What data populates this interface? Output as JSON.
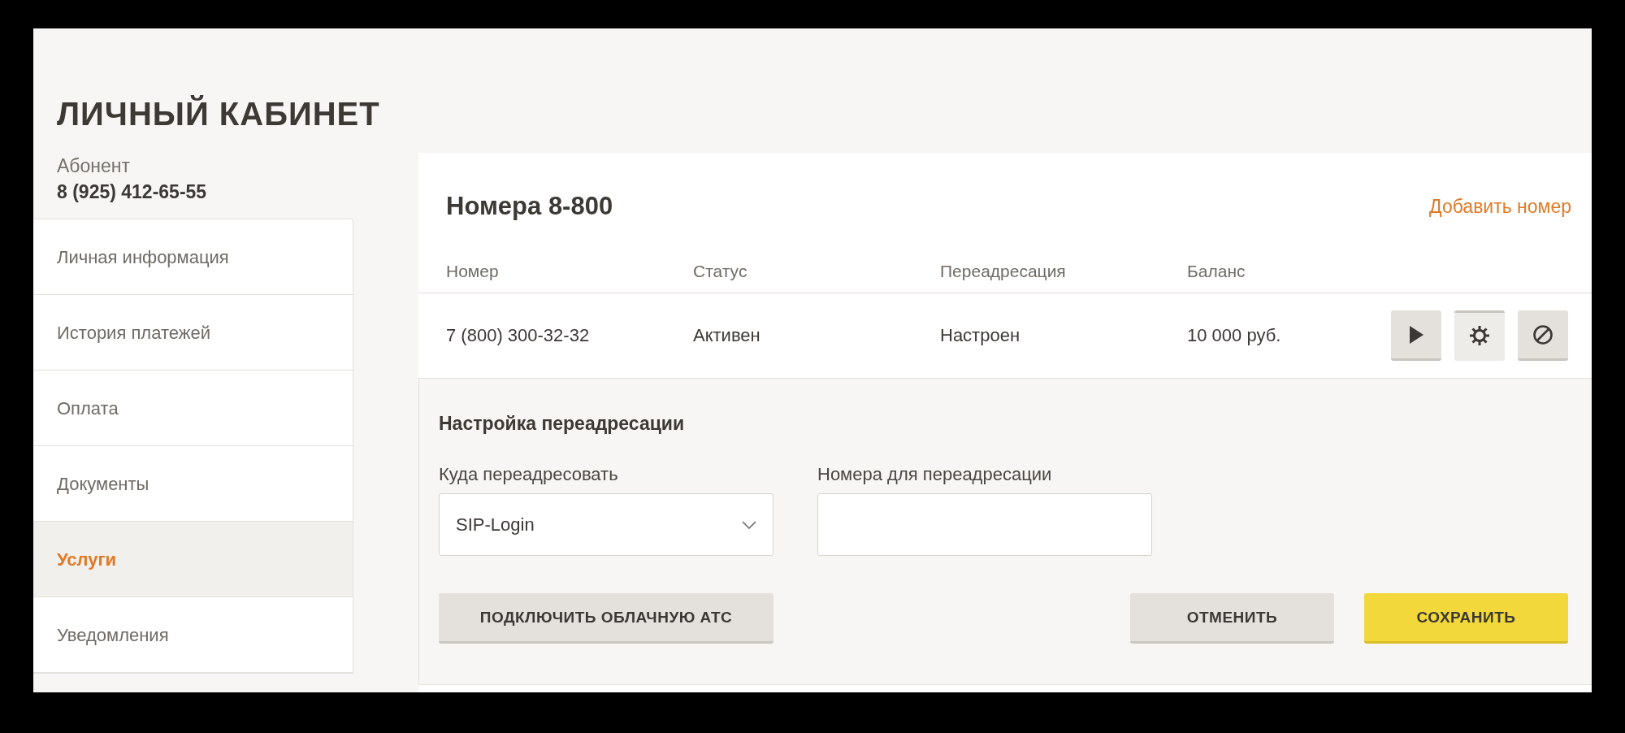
{
  "page": {
    "title": "ЛИЧНЫЙ КАБИНЕТ"
  },
  "subscriber": {
    "label": "Абонент",
    "phone": "8 (925) 412-65-55"
  },
  "sidebar": {
    "items": [
      {
        "label": "Личная информация",
        "selected": false
      },
      {
        "label": "История платежей",
        "selected": false
      },
      {
        "label": "Оплата",
        "selected": false
      },
      {
        "label": "Документы",
        "selected": false
      },
      {
        "label": "Услуги",
        "selected": true
      },
      {
        "label": "Уведомления",
        "selected": false
      }
    ]
  },
  "panel": {
    "title": "Номера 8-800",
    "add_link": "Добавить номер",
    "table": {
      "columns": [
        "Номер",
        "Статус",
        "Переадресация",
        "Баланс"
      ],
      "rows": [
        {
          "cells": [
            "7 (800) 300-32-32",
            "Активен",
            "Настроен",
            "10 000 руб."
          ],
          "actions": [
            {
              "kind": "play",
              "selected": false
            },
            {
              "kind": "settings",
              "selected": true
            },
            {
              "kind": "block",
              "selected": false
            }
          ]
        }
      ]
    },
    "forwarding": {
      "title": "Настройка переадресации",
      "target": {
        "label": "Куда переадресовать",
        "value": "SIP-Login"
      },
      "numbers": {
        "label": "Номера для переадресации"
      },
      "buttons": [
        {
          "kind": "secondary",
          "label": "ПОДКЛЮЧИТЬ ОБЛАЧНУЮ АТС"
        },
        {
          "kind": "spacer-secondary",
          "label": "ОТМЕНИТЬ"
        },
        {
          "kind": "primary",
          "label": "СОХРАНИТЬ"
        }
      ]
    }
  }
}
